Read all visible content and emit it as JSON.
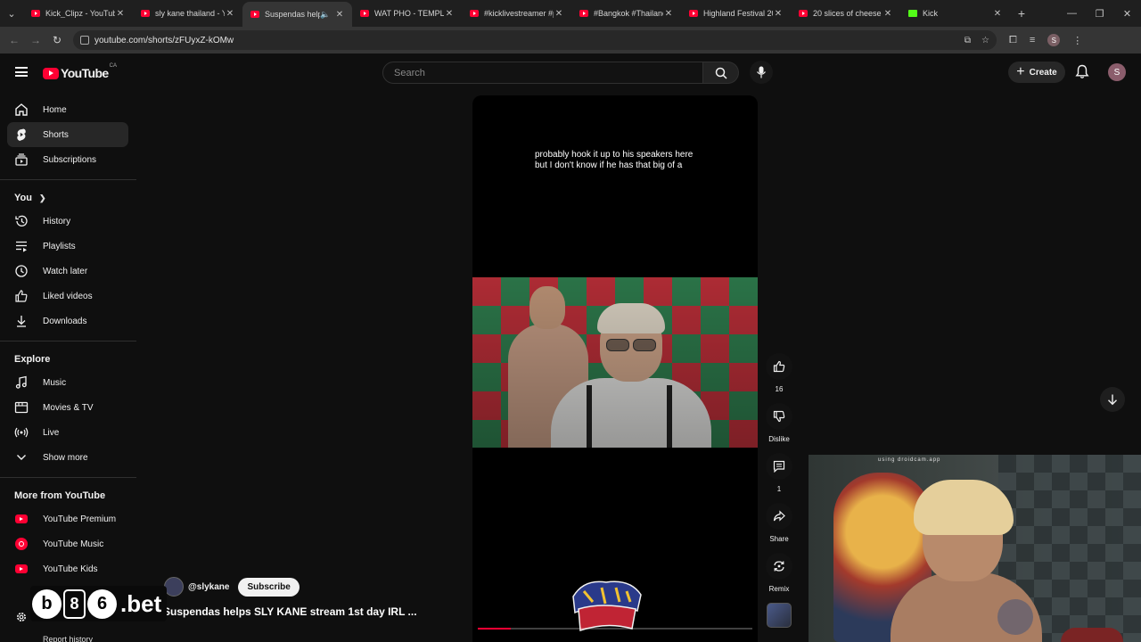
{
  "browser": {
    "tabs": [
      {
        "title": "Kick_Clipz - YouTube",
        "favicon": "youtube-favicon",
        "active": false
      },
      {
        "title": "sly kane thailand - Yo",
        "favicon": "youtube-favicon",
        "active": false
      },
      {
        "title": "Suspendas helps",
        "favicon": "youtube-favicon",
        "active": true,
        "audio": true
      },
      {
        "title": "WAT PHO - TEMPLE",
        "favicon": "youtube-favicon",
        "active": false
      },
      {
        "title": "#kicklivestreamer #p",
        "favicon": "youtube-favicon",
        "active": false
      },
      {
        "title": "#Bangkok #Thailand",
        "favicon": "youtube-favicon",
        "active": false
      },
      {
        "title": "Highland Festival 20",
        "favicon": "youtube-favicon",
        "active": false
      },
      {
        "title": "20 slices of cheese b",
        "favicon": "youtube-favicon",
        "active": false
      },
      {
        "title": "Kick",
        "favicon": "kick-favicon",
        "active": false
      }
    ],
    "url": "youtube.com/shorts/zFUyxZ-kOMw",
    "profile_initial": "S"
  },
  "masthead": {
    "logo_text": "YouTube",
    "country_code": "CA",
    "search_placeholder": "Search",
    "create_label": "Create",
    "avatar_initial": "S"
  },
  "sidebar": {
    "main": [
      {
        "label": "Home",
        "icon": "home-icon"
      },
      {
        "label": "Shorts",
        "icon": "shorts-icon",
        "active": true
      },
      {
        "label": "Subscriptions",
        "icon": "subscriptions-icon"
      }
    ],
    "you_heading": "You",
    "you": [
      {
        "label": "History",
        "icon": "history-icon"
      },
      {
        "label": "Playlists",
        "icon": "playlists-icon"
      },
      {
        "label": "Watch later",
        "icon": "watch-later-icon"
      },
      {
        "label": "Liked videos",
        "icon": "liked-videos-icon"
      },
      {
        "label": "Downloads",
        "icon": "downloads-icon"
      }
    ],
    "explore_heading": "Explore",
    "explore": [
      {
        "label": "Music",
        "icon": "music-icon"
      },
      {
        "label": "Movies & TV",
        "icon": "movies-icon"
      },
      {
        "label": "Live",
        "icon": "live-icon"
      },
      {
        "label": "Show more",
        "icon": "chevron-down-icon"
      }
    ],
    "more_heading": "More from YouTube",
    "more": [
      {
        "label": "YouTube Premium",
        "icon": "youtube-premium-icon"
      },
      {
        "label": "YouTube Music",
        "icon": "youtube-music-icon"
      },
      {
        "label": "YouTube Kids",
        "icon": "youtube-kids-icon"
      }
    ],
    "report_history": "Report history"
  },
  "short": {
    "caption": "probably hook it up to his speakers here\nbut I don't know if he has that big of a",
    "channel_handle": "@slykane",
    "subscribe_label": "Subscribe",
    "title": "Suspendas helps SLY KANE  stream 1st day IRL ...",
    "progress": 0.12,
    "actions": {
      "like_count": "16",
      "dislike_label": "Dislike",
      "comment_count": "1",
      "share_label": "Share",
      "remix_label": "Remix"
    }
  },
  "webcam": {
    "label": "using droidcam.app"
  },
  "sponsor": {
    "parts": [
      "b",
      "8",
      "6"
    ],
    "suffix": ".bet"
  },
  "colors": {
    "youtube_red": "#ff0033",
    "kick_green": "#53fc18",
    "background": "#0f0f0f"
  }
}
